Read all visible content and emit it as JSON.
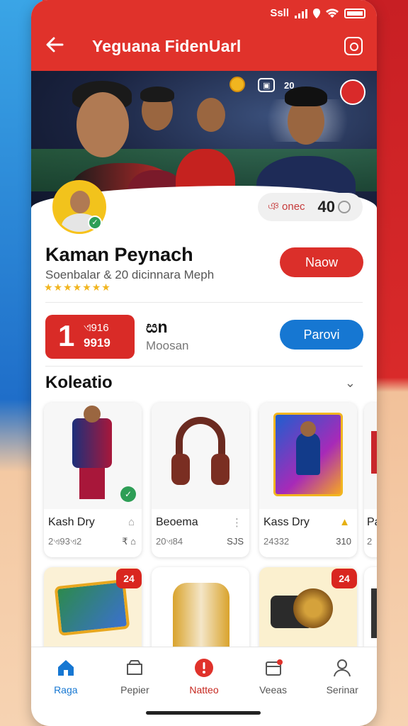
{
  "status": {
    "carrier": "Ssll"
  },
  "header": {
    "title": "Yeguana FidenUarl"
  },
  "banner": {
    "badge1": "20",
    "badge_icon": "trophy"
  },
  "profile": {
    "points_label": "ঞ onec",
    "points_value": "40",
    "name": "Kaman Peynach",
    "subline": "Soenbalar  & 20 dicinnara Meph",
    "stars": "★★★★★★★",
    "action_button": "Naow"
  },
  "stats": {
    "rank_num": "1",
    "rank_line1": "ଏ916",
    "rank_line2": "9919",
    "mid_value": "සn",
    "mid_label": "Moosan",
    "action_button": "Parovi"
  },
  "collection": {
    "title": "Koleatio",
    "items": [
      {
        "title": "Kash Dry",
        "meta": "2ଏ93ଏ2",
        "price": "₹ ⌂"
      },
      {
        "title": "Beoema",
        "meta": "20ଏ84",
        "price": "SJS"
      },
      {
        "title": "Kass Dry",
        "meta": "24332",
        "price": "310"
      },
      {
        "title": "Pa",
        "meta": "2",
        "price": ""
      }
    ],
    "row2_badges": [
      "24",
      "24"
    ]
  },
  "tabs": [
    {
      "label": "Raga",
      "icon": "home-icon",
      "active": true
    },
    {
      "label": "Pepier",
      "icon": "box-icon",
      "active": false
    },
    {
      "label": "Natteo",
      "icon": "alert-icon",
      "active": false
    },
    {
      "label": "Veeas",
      "icon": "package-icon",
      "active": false
    },
    {
      "label": "Serinar",
      "icon": "user-icon",
      "active": false
    }
  ],
  "colors": {
    "primary_red": "#e0322b",
    "blue": "#1677d2",
    "gold": "#f1b51f"
  }
}
